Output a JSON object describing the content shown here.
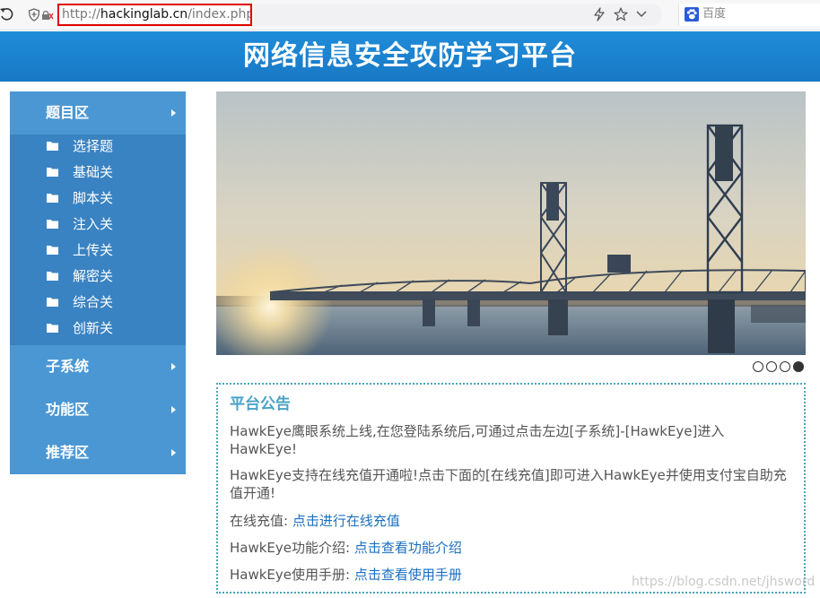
{
  "browser": {
    "url_scheme": "http://",
    "url_host": "hackinglab.cn",
    "url_path": "/index.php",
    "search_placeholder": "百度"
  },
  "site": {
    "title": "网络信息安全攻防学习平台"
  },
  "sidebar": {
    "sections": [
      {
        "label": "题目区",
        "items": [
          "选择题",
          "基础关",
          "脚本关",
          "注入关",
          "上传关",
          "解密关",
          "综合关",
          "创新关"
        ]
      },
      {
        "label": "子系统"
      },
      {
        "label": "功能区"
      },
      {
        "label": "推荐区"
      }
    ]
  },
  "banner": {
    "slide_count": 4,
    "active_slide": 4
  },
  "notice": {
    "title": "平台公告",
    "p1": "HawkEye鹰眼系统上线,在您登陆系统后,可通过点击左边[子系统]-[HawkEye]进入HawkEye!",
    "p2": "HawkEye支持在线充值开通啦!点击下面的[在线充值]即可进入HawkEye并使用支付宝自助充值开通!",
    "recharge_label": "在线充值: ",
    "recharge_link": "点击进行在线充值",
    "intro_label": "HawkEye功能介绍: ",
    "intro_link": "点击查看功能介绍",
    "manual_label": "HawkEye使用手册: ",
    "manual_link": "点击查看使用手册"
  },
  "watermark": "https://blog.csdn.net/jhsword",
  "colors": {
    "header": "#1f8cd9",
    "sidebar": "#4a97d4",
    "sidebar_sub": "#3a83c2",
    "notice_title": "#4aa3c6",
    "link": "#1b6fc0",
    "url_highlight": "#e00000"
  }
}
